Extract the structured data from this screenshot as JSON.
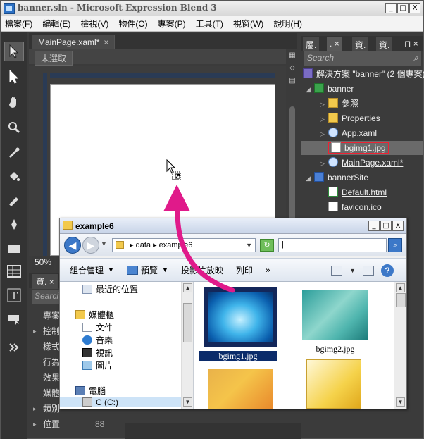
{
  "window": {
    "title": "banner.sln - Microsoft Expression Blend 3",
    "controls": [
      "_",
      "□",
      "X"
    ]
  },
  "menu": [
    "檔案(F)",
    "編輯(E)",
    "檢視(V)",
    "物件(O)",
    "專案(P)",
    "工具(T)",
    "視窗(W)",
    "說明(H)"
  ],
  "document": {
    "tab_label": "MainPage.xaml*",
    "tab_close": "×",
    "selection_status": "未選取",
    "zoom": "50%"
  },
  "left_panel": {
    "tab_label": "資.",
    "tab_close": "×",
    "search_placeholder": "Search",
    "items": [
      {
        "label": "專案",
        "arrow": ""
      },
      {
        "label": "控制",
        "arrow": "▸"
      },
      {
        "label": "樣式",
        "arrow": ""
      },
      {
        "label": "行為",
        "arrow": ""
      },
      {
        "label": "效果",
        "arrow": ""
      },
      {
        "label": "媒體",
        "arrow": ""
      },
      {
        "label": "類別",
        "arrow": "▸"
      },
      {
        "label": "位置",
        "arrow": "▸",
        "num": "88"
      }
    ]
  },
  "right_panel": {
    "tabs": [
      "屬.",
      ".",
      "資.",
      "資."
    ],
    "search_placeholder": "Search",
    "tree": [
      {
        "label": "解決方案 \"banner\" (2 個專案)",
        "icon": "solution",
        "twisty": ""
      },
      {
        "label": "banner",
        "icon": "project",
        "twisty": "◢"
      },
      {
        "label": "參照",
        "icon": "folder",
        "twisty": "▷"
      },
      {
        "label": "Properties",
        "icon": "folder",
        "twisty": "▷"
      },
      {
        "label": "App.xaml",
        "icon": "xaml",
        "twisty": "▷"
      },
      {
        "label": "bgimg1.jpg",
        "icon": "image",
        "twisty": ""
      },
      {
        "label": "MainPage.xaml*",
        "icon": "xaml",
        "twisty": "▷"
      },
      {
        "label": "bannerSite",
        "icon": "web",
        "twisty": "◢"
      },
      {
        "label": "Default.html",
        "icon": "html",
        "twisty": ""
      },
      {
        "label": "favicon.ico",
        "icon": "image",
        "twisty": ""
      }
    ]
  },
  "explorer": {
    "title": "example6",
    "address": [
      "data",
      "example6"
    ],
    "search_value": "|",
    "commands": [
      {
        "label": "組合管理",
        "caret": "▼"
      },
      {
        "label": "預覽",
        "caret": "▼"
      },
      {
        "label": "投影片放映",
        "caret": ""
      },
      {
        "label": "列印",
        "caret": ""
      },
      {
        "label": "»",
        "caret": ""
      }
    ],
    "nav": [
      {
        "label": "最近的位置",
        "icon": "recent"
      },
      {
        "label": "媒體櫃",
        "icon": "library"
      },
      {
        "label": "文件",
        "icon": "documents"
      },
      {
        "label": "音樂",
        "icon": "music"
      },
      {
        "label": "視訊",
        "icon": "video"
      },
      {
        "label": "圖片",
        "icon": "pictures"
      },
      {
        "label": "電腦",
        "icon": "computer"
      },
      {
        "label": "C (C:)",
        "icon": "drive"
      }
    ],
    "files": [
      {
        "name": "bgimg1.jpg",
        "selected": true
      },
      {
        "name": "bgimg2.jpg",
        "selected": false
      },
      {
        "name": "",
        "selected": false
      },
      {
        "name": "",
        "selected": false
      }
    ]
  },
  "colors": {
    "drag_arrow": "#e01a8a",
    "selection_box": "#e02233"
  }
}
